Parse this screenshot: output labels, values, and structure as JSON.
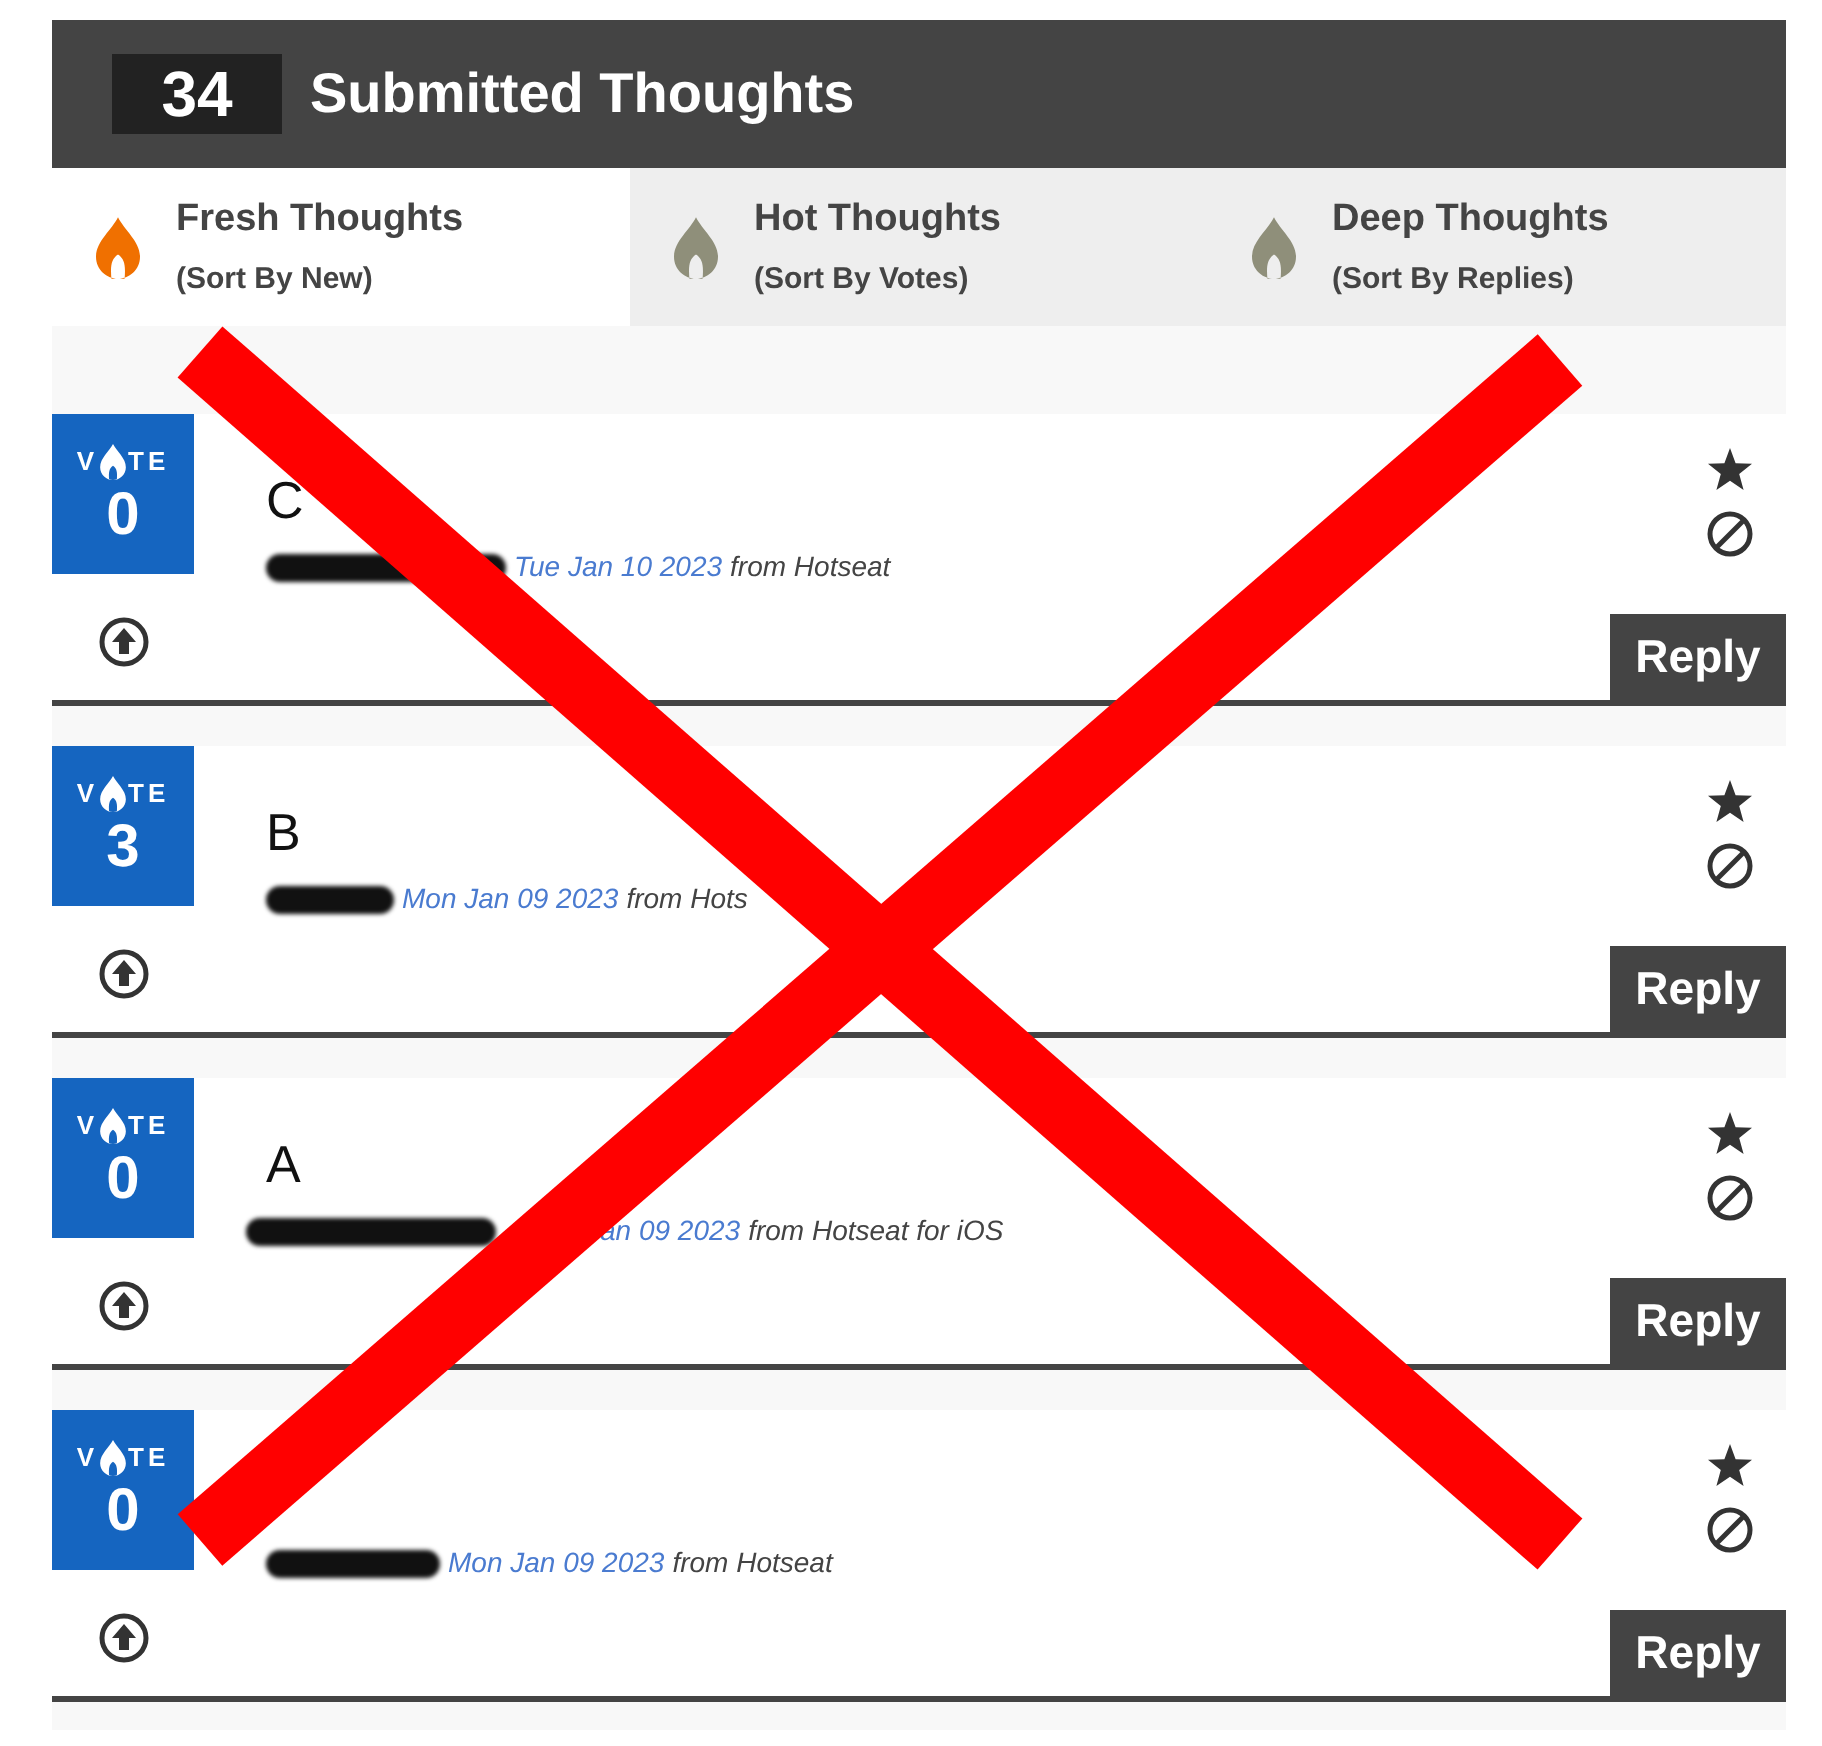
{
  "header": {
    "count": "34",
    "title": "Submitted Thoughts"
  },
  "tabs": [
    {
      "label": "Fresh Thoughts",
      "sublabel": "(Sort By New)",
      "selected": true
    },
    {
      "label": "Hot Thoughts",
      "sublabel": "(Sort By Votes)",
      "selected": false
    },
    {
      "label": "Deep Thoughts",
      "sublabel": "(Sort By Replies)",
      "selected": false
    }
  ],
  "posts": [
    {
      "vote_prefix": "V",
      "vote_suffix": "TE",
      "votes": "0",
      "title": "C",
      "author_redacted": true,
      "date": "Tue Jan 10 2023",
      "source": "from Hotseat",
      "reply": "Reply"
    },
    {
      "vote_prefix": "V",
      "vote_suffix": "TE",
      "votes": "3",
      "title": "B",
      "author_redacted": true,
      "date": "Mon Jan 09 2023",
      "source": "from Hots",
      "reply": "Reply"
    },
    {
      "vote_prefix": "V",
      "vote_suffix": "TE",
      "votes": "0",
      "title": "A",
      "author_redacted": true,
      "date": "an 09 2023",
      "source": "from Hotseat for iOS",
      "reply": "Reply"
    },
    {
      "vote_prefix": "V",
      "vote_suffix": "TE",
      "votes": "0",
      "author_redacted": true,
      "date": "Mon Jan 09 2023",
      "source": "from Hotseat",
      "reply": "Reply"
    }
  ],
  "annotation": {
    "kind": "cross"
  }
}
